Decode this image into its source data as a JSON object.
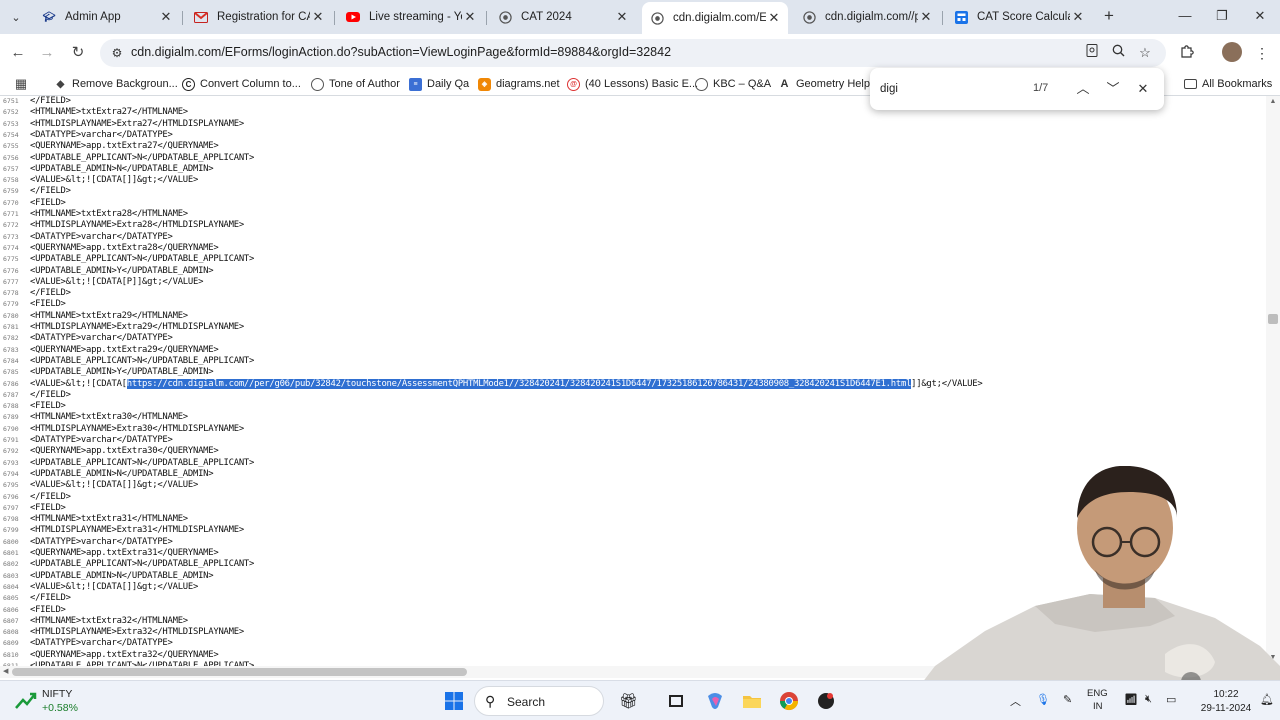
{
  "browser": {
    "tabs": [
      {
        "label": "Admin App",
        "icon": "admin-app-favicon",
        "x": 0
      },
      {
        "label": "Registration for CAT",
        "icon": "gmail-favicon"
      },
      {
        "label": "Live streaming - You",
        "icon": "youtube-favicon"
      },
      {
        "label": "CAT 2024",
        "icon": "globe-favicon"
      },
      {
        "label": "cdn.digialm.com/EFo",
        "icon": "globe-favicon",
        "active": true
      },
      {
        "label": "cdn.digialm.com//pe",
        "icon": "globe-favicon"
      },
      {
        "label": "CAT Score Calculator",
        "icon": "calculator-favicon"
      }
    ],
    "url": "cdn.digialm.com/EForms/loginAction.do?subAction=ViewLoginPage&formId=89884&orgId=32842",
    "bookmarks": [
      {
        "label": "Remove Backgroun...",
        "icon": "diamond-icon",
        "color": "#444444"
      },
      {
        "label": "Convert Column to...",
        "icon": "c-logo-icon",
        "color": "#222222"
      },
      {
        "label": "Tone of Author",
        "icon": "globe-icon",
        "color": "#555555"
      },
      {
        "label": "Daily Qa",
        "icon": "doc-icon",
        "color": "#3b6fd4"
      },
      {
        "label": "diagrams.net",
        "icon": "drawio-icon",
        "color": "#f08705"
      },
      {
        "label": "(40 Lessons) Basic E...",
        "icon": "swirl-icon",
        "color": "#d33"
      },
      {
        "label": "KBC – Q&A",
        "icon": "globe-icon",
        "color": "#555555"
      },
      {
        "label": "Geometry Help",
        "icon": "a-icon",
        "color": "#333333"
      }
    ],
    "all_bookmarks": "All Bookmarks"
  },
  "find": {
    "query": "digi",
    "count": "1/7"
  },
  "code": {
    "lines": [
      {
        "n": "6751",
        "text": "</FIELD>"
      },
      {
        "n": "6752",
        "text": "<HTMLNAME>txtExtra27</HTMLNAME>"
      },
      {
        "n": "6753",
        "text": "<HTMLDISPLAYNAME>Extra27</HTMLDISPLAYNAME>"
      },
      {
        "n": "6754",
        "text": "<DATATYPE>varchar</DATATYPE>"
      },
      {
        "n": "6755",
        "text": "<QUERYNAME>app.txtExtra27</QUERYNAME>"
      },
      {
        "n": "6756",
        "text": "<UPDATABLE_APPLICANT>N</UPDATABLE_APPLICANT>"
      },
      {
        "n": "6757",
        "text": "<UPDATABLE_ADMIN>N</UPDATABLE_ADMIN>"
      },
      {
        "n": "6758",
        "text": "<VALUE>&lt;![CDATA[]]&gt;</VALUE>"
      },
      {
        "n": "6759",
        "text": "</FIELD>"
      },
      {
        "n": "6770",
        "text": "<FIELD>"
      },
      {
        "n": "6771",
        "text": "<HTMLNAME>txtExtra28</HTMLNAME>"
      },
      {
        "n": "6772",
        "text": "<HTMLDISPLAYNAME>Extra28</HTMLDISPLAYNAME>"
      },
      {
        "n": "6773",
        "text": "<DATATYPE>varchar</DATATYPE>"
      },
      {
        "n": "6774",
        "text": "<QUERYNAME>app.txtExtra28</QUERYNAME>"
      },
      {
        "n": "6775",
        "text": "<UPDATABLE_APPLICANT>N</UPDATABLE_APPLICANT>"
      },
      {
        "n": "6776",
        "text": "<UPDATABLE_ADMIN>Y</UPDATABLE_ADMIN>"
      },
      {
        "n": "6777",
        "text": "<VALUE>&lt;![CDATA[P]]&gt;</VALUE>"
      },
      {
        "n": "6778",
        "text": "</FIELD>"
      },
      {
        "n": "6779",
        "text": "<FIELD>"
      },
      {
        "n": "6780",
        "text": "<HTMLNAME>txtExtra29</HTMLNAME>"
      },
      {
        "n": "6781",
        "text": "<HTMLDISPLAYNAME>Extra29</HTMLDISPLAYNAME>"
      },
      {
        "n": "6782",
        "text": "<DATATYPE>varchar</DATATYPE>"
      },
      {
        "n": "6783",
        "text": "<QUERYNAME>app.txtExtra29</QUERYNAME>"
      },
      {
        "n": "6784",
        "text": "<UPDATABLE_APPLICANT>N</UPDATABLE_APPLICANT>"
      },
      {
        "n": "6785",
        "text": "<UPDATABLE_ADMIN>Y</UPDATABLE_ADMIN>"
      },
      {
        "n": "6786",
        "text": "<VALUE>&lt;![CDATA[",
        "highlight": "https://cdn.digialm.com//per/g06/pub/32842/touchstone/AssessmentQPHTMLMode1//328420241/328420241S1D6447/17325186126786431/24380908_328420241S1D6447E1.html",
        "after": "]]&gt;</VALUE>"
      },
      {
        "n": "6787",
        "text": "</FIELD>"
      },
      {
        "n": "6788",
        "text": "<FIELD>"
      },
      {
        "n": "6789",
        "text": "<HTMLNAME>txtExtra30</HTMLNAME>"
      },
      {
        "n": "6790",
        "text": "<HTMLDISPLAYNAME>Extra30</HTMLDISPLAYNAME>"
      },
      {
        "n": "6791",
        "text": "<DATATYPE>varchar</DATATYPE>"
      },
      {
        "n": "6792",
        "text": "<QUERYNAME>app.txtExtra30</QUERYNAME>"
      },
      {
        "n": "6793",
        "text": "<UPDATABLE_APPLICANT>N</UPDATABLE_APPLICANT>"
      },
      {
        "n": "6794",
        "text": "<UPDATABLE_ADMIN>N</UPDATABLE_ADMIN>"
      },
      {
        "n": "6795",
        "text": "<VALUE>&lt;![CDATA[]]&gt;</VALUE>"
      },
      {
        "n": "6796",
        "text": "</FIELD>"
      },
      {
        "n": "6797",
        "text": "<FIELD>"
      },
      {
        "n": "6798",
        "text": "<HTMLNAME>txtExtra31</HTMLNAME>"
      },
      {
        "n": "6799",
        "text": "<HTMLDISPLAYNAME>Extra31</HTMLDISPLAYNAME>"
      },
      {
        "n": "6800",
        "text": "<DATATYPE>varchar</DATATYPE>"
      },
      {
        "n": "6801",
        "text": "<QUERYNAME>app.txtExtra31</QUERYNAME>"
      },
      {
        "n": "6802",
        "text": "<UPDATABLE_APPLICANT>N</UPDATABLE_APPLICANT>"
      },
      {
        "n": "6803",
        "text": "<UPDATABLE_ADMIN>N</UPDATABLE_ADMIN>"
      },
      {
        "n": "6804",
        "text": "<VALUE>&lt;![CDATA[]]&gt;</VALUE>"
      },
      {
        "n": "6805",
        "text": "</FIELD>"
      },
      {
        "n": "6806",
        "text": "<FIELD>"
      },
      {
        "n": "6807",
        "text": "<HTMLNAME>txtExtra32</HTMLNAME>"
      },
      {
        "n": "6808",
        "text": "<HTMLDISPLAYNAME>Extra32</HTMLDISPLAYNAME>"
      },
      {
        "n": "6809",
        "text": "<DATATYPE>varchar</DATATYPE>"
      },
      {
        "n": "6810",
        "text": "<QUERYNAME>app.txtExtra32</QUERYNAME>"
      },
      {
        "n": "6811",
        "text": "<UPDATABLE_APPLICANT>N</UPDATABLE_APPLICANT>"
      }
    ]
  },
  "taskbar": {
    "ticker_name": "NIFTY",
    "ticker_change": "+0.58%",
    "search_label": "Search",
    "language": "ENG",
    "region": "IN",
    "time": "10:22",
    "date": "29-11-2024"
  },
  "colors": {
    "highlight": "#2f6fd1",
    "tabstrip": "#dfe5ee",
    "ticker_positive": "#1a7d2a"
  }
}
